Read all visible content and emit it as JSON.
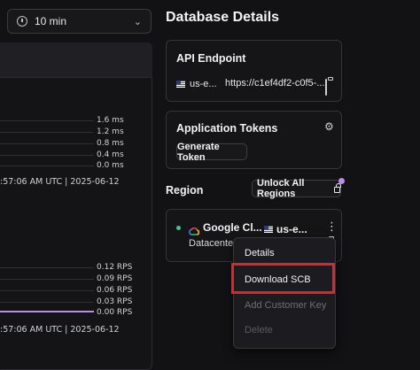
{
  "toolbar": {
    "time_range": "10 min"
  },
  "latency_chart": {
    "ticks": [
      "1.6 ms",
      "1.2 ms",
      "0.8 ms",
      "0.4 ms",
      "0.0 ms"
    ],
    "timestamp": ":57:06 AM UTC | 2025-06-12"
  },
  "rps_chart": {
    "ticks": [
      "0.12 RPS",
      "0.09 RPS",
      "0.06 RPS",
      "0.03 RPS",
      "0.00 RPS"
    ],
    "timestamp": ":57:06 AM UTC | 2025-06-12",
    "line_color": "#b98cf0"
  },
  "details": {
    "title": "Database Details",
    "api_endpoint": {
      "title": "API Endpoint",
      "region_short": "us-e...",
      "url": "https://c1ef4df2-c0f5-..."
    },
    "app_tokens": {
      "title": "Application Tokens",
      "generate_label": "Generate Token"
    },
    "region": {
      "title": "Region",
      "unlock_label": "Unlock All Regions",
      "provider": "Google Cl...",
      "region_short": "us-e...",
      "subtitle": "Datacenter"
    }
  },
  "menu": {
    "items": [
      "Details",
      "Download SCB",
      "Add Customer Key",
      "Delete"
    ],
    "highlight_color": "#e3232b"
  },
  "chart_data": [
    {
      "type": "line",
      "yticks": [
        "0.0 ms",
        "0.4 ms",
        "0.8 ms",
        "1.2 ms",
        "1.6 ms"
      ],
      "ylim": [
        0,
        1.6
      ],
      "xlabel": ":57:06 AM UTC | 2025-06-12",
      "grid": true
    },
    {
      "type": "line",
      "yticks": [
        "0.00 RPS",
        "0.03 RPS",
        "0.06 RPS",
        "0.09 RPS",
        "0.12 RPS"
      ],
      "ylim": [
        0,
        0.12
      ],
      "xlabel": ":57:06 AM UTC | 2025-06-12",
      "series": [
        {
          "values": [
            0,
            0
          ]
        }
      ],
      "grid": true
    }
  ]
}
